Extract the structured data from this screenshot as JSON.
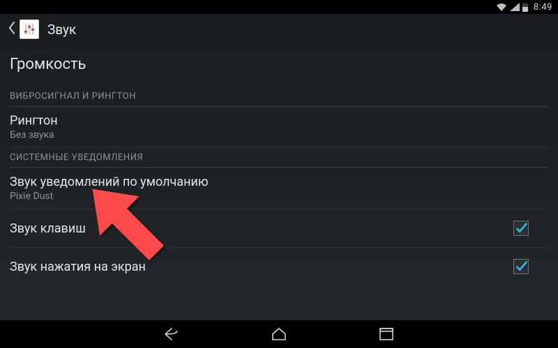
{
  "status_bar": {
    "clock": "8:49"
  },
  "header": {
    "title": "Звук"
  },
  "volume_heading": "Громкость",
  "section_vibrate_ringtone": "ВИБРОСИГНАЛ И РИНГТОН",
  "ringtone": {
    "title": "Рингтон",
    "summary": "Без звука"
  },
  "section_system_notifications": "СИСТЕМНЫЕ УВЕДОМЛЕНИЯ",
  "default_notification": {
    "title": "Звук уведомлений по умолчанию",
    "summary": "Pixie Dust"
  },
  "dial_pad_sounds": {
    "title": "Звук клавиш",
    "checked": true
  },
  "touch_sounds": {
    "title": "Звук нажатия на экран",
    "checked": true
  },
  "colors": {
    "accent_check": "#33b5e5",
    "arrow": "#ff4a4b"
  }
}
